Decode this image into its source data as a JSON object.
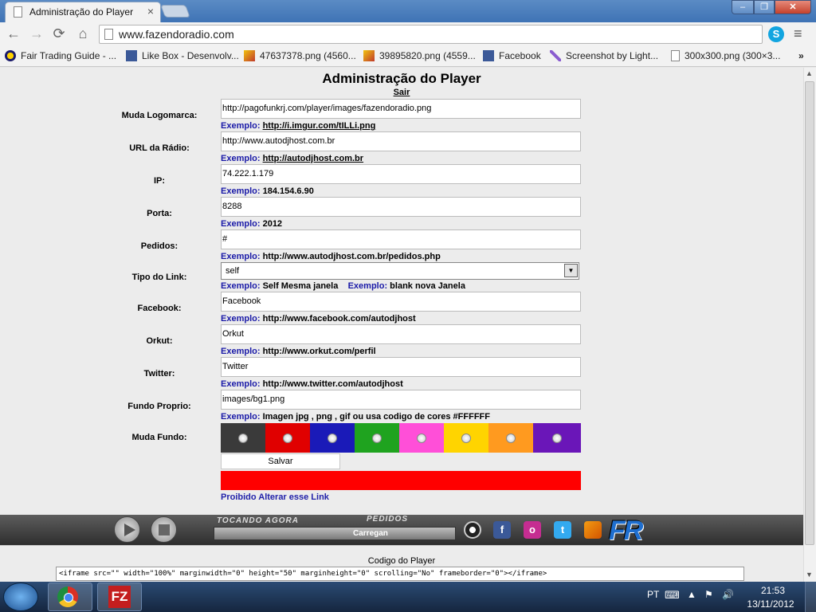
{
  "browser": {
    "tab_title": "Administração do Player",
    "tab_close": "×",
    "url": "www.fazendoradio.com",
    "window_controls": {
      "minimize": "–",
      "maximize": "❐",
      "close": "✕"
    },
    "nav": {
      "back": "←",
      "forward": "→",
      "reload": "⟳",
      "home": "⌂",
      "menu": "≡",
      "skype": "S"
    },
    "bookmarks": [
      "Fair Trading Guide - ...",
      "Like Box - Desenvolv...",
      "47637378.png (4560...",
      "39895820.png (4559...",
      "Facebook",
      "Screenshot by Light...",
      "300x300.png (300×3..."
    ],
    "bookmarks_more": "»"
  },
  "page": {
    "title": "Administração do Player",
    "logout": "Sair",
    "fields": {
      "logo": {
        "label": "Muda Logomarca:",
        "value": "http://pagofunkrj.com/player/images/fazendoradio.png",
        "example_prefix": "Exemplo:",
        "example": "http://i.imgur.com/tILLi.png"
      },
      "radio_url": {
        "label": "URL da Rádio:",
        "value": "http://www.autodjhost.com.br",
        "example_prefix": "Exemplo:",
        "example": "http://autodjhost.com.br"
      },
      "ip": {
        "label": "IP:",
        "value": "74.222.1.179",
        "example_prefix": "Exemplo:",
        "example": "184.154.6.90"
      },
      "port": {
        "label": "Porta:",
        "value": "8288",
        "example_prefix": "Exemplo:",
        "example": "2012"
      },
      "requests": {
        "label": "Pedidos:",
        "value": "#",
        "example_prefix": "Exemplo:",
        "example": "http://www.autodjhost.com.br/pedidos.php"
      },
      "link_type": {
        "label": "Tipo do Link:",
        "value": "self",
        "arrow": "▼",
        "example_prefix": "Exemplo:",
        "example": "Self Mesma janela",
        "example2_prefix": "Exemplo:",
        "example2": "blank nova Janela"
      },
      "facebook": {
        "label": "Facebook:",
        "value": "Facebook",
        "example_prefix": "Exemplo:",
        "example": "http://www.facebook.com/autodjhost"
      },
      "orkut": {
        "label": "Orkut:",
        "value": "Orkut",
        "example_prefix": "Exemplo:",
        "example": "http://www.orkut.com/perfil"
      },
      "twitter": {
        "label": "Twitter:",
        "value": "Twitter",
        "example_prefix": "Exemplo:",
        "example": "http://www.twitter.com/autodjhost"
      },
      "background": {
        "label": "Fundo Proprio:",
        "value": "images/bg1.png",
        "example_prefix": "Exemplo:",
        "example": "Imagen jpg , png , gif ou usa codigo de cores #FFFFFF"
      }
    },
    "change_background_label": "Muda Fundo:",
    "swatch_colors": [
      "#3a3a3a",
      "#e00000",
      "#1a1ab8",
      "#1fa31f",
      "#ff4fd8",
      "#ffd400",
      "#ff9a1f",
      "#6a16b8"
    ],
    "save_label": "Salvar",
    "forbidden_link": "Proibido Alterar esse Link",
    "player": {
      "now_playing": "TOCANDO AGORA",
      "requests": "PEDIDOS",
      "loading": "Carregan",
      "logo": "FR",
      "social": {
        "facebook": "f",
        "orkut": "o",
        "twitter": "t"
      }
    },
    "code_label": "Codigo do Player",
    "code_value": "<iframe src=\"\" width=\"100%\" marginwidth=\"0\" height=\"50\" marginheight=\"0\" scrolling=\"No\" frameborder=\"0\"></iframe>"
  },
  "taskbar": {
    "language": "PT",
    "time": "21:53",
    "date": "13/11/2012",
    "filezilla": "FZ"
  }
}
